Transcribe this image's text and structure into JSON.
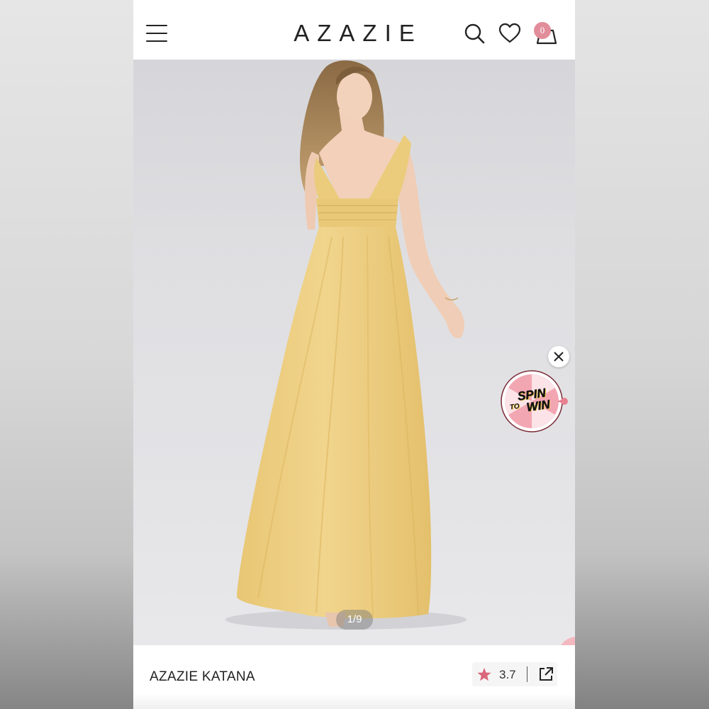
{
  "header": {
    "brand": "AZAZIE",
    "cart_count": "0",
    "icons": [
      "menu-icon",
      "search-icon",
      "heart-icon",
      "shopping-bag-icon"
    ]
  },
  "gallery": {
    "counter": "1/9",
    "dress_color": "#ecd082"
  },
  "promo": {
    "line1": "SPIN",
    "line2": "TO",
    "line3": "WIN"
  },
  "product": {
    "name": "AZAZIE KATANA",
    "rating": "3.7"
  },
  "colors": {
    "accent_pink": "#e28d9a",
    "star": "#d9667a"
  }
}
